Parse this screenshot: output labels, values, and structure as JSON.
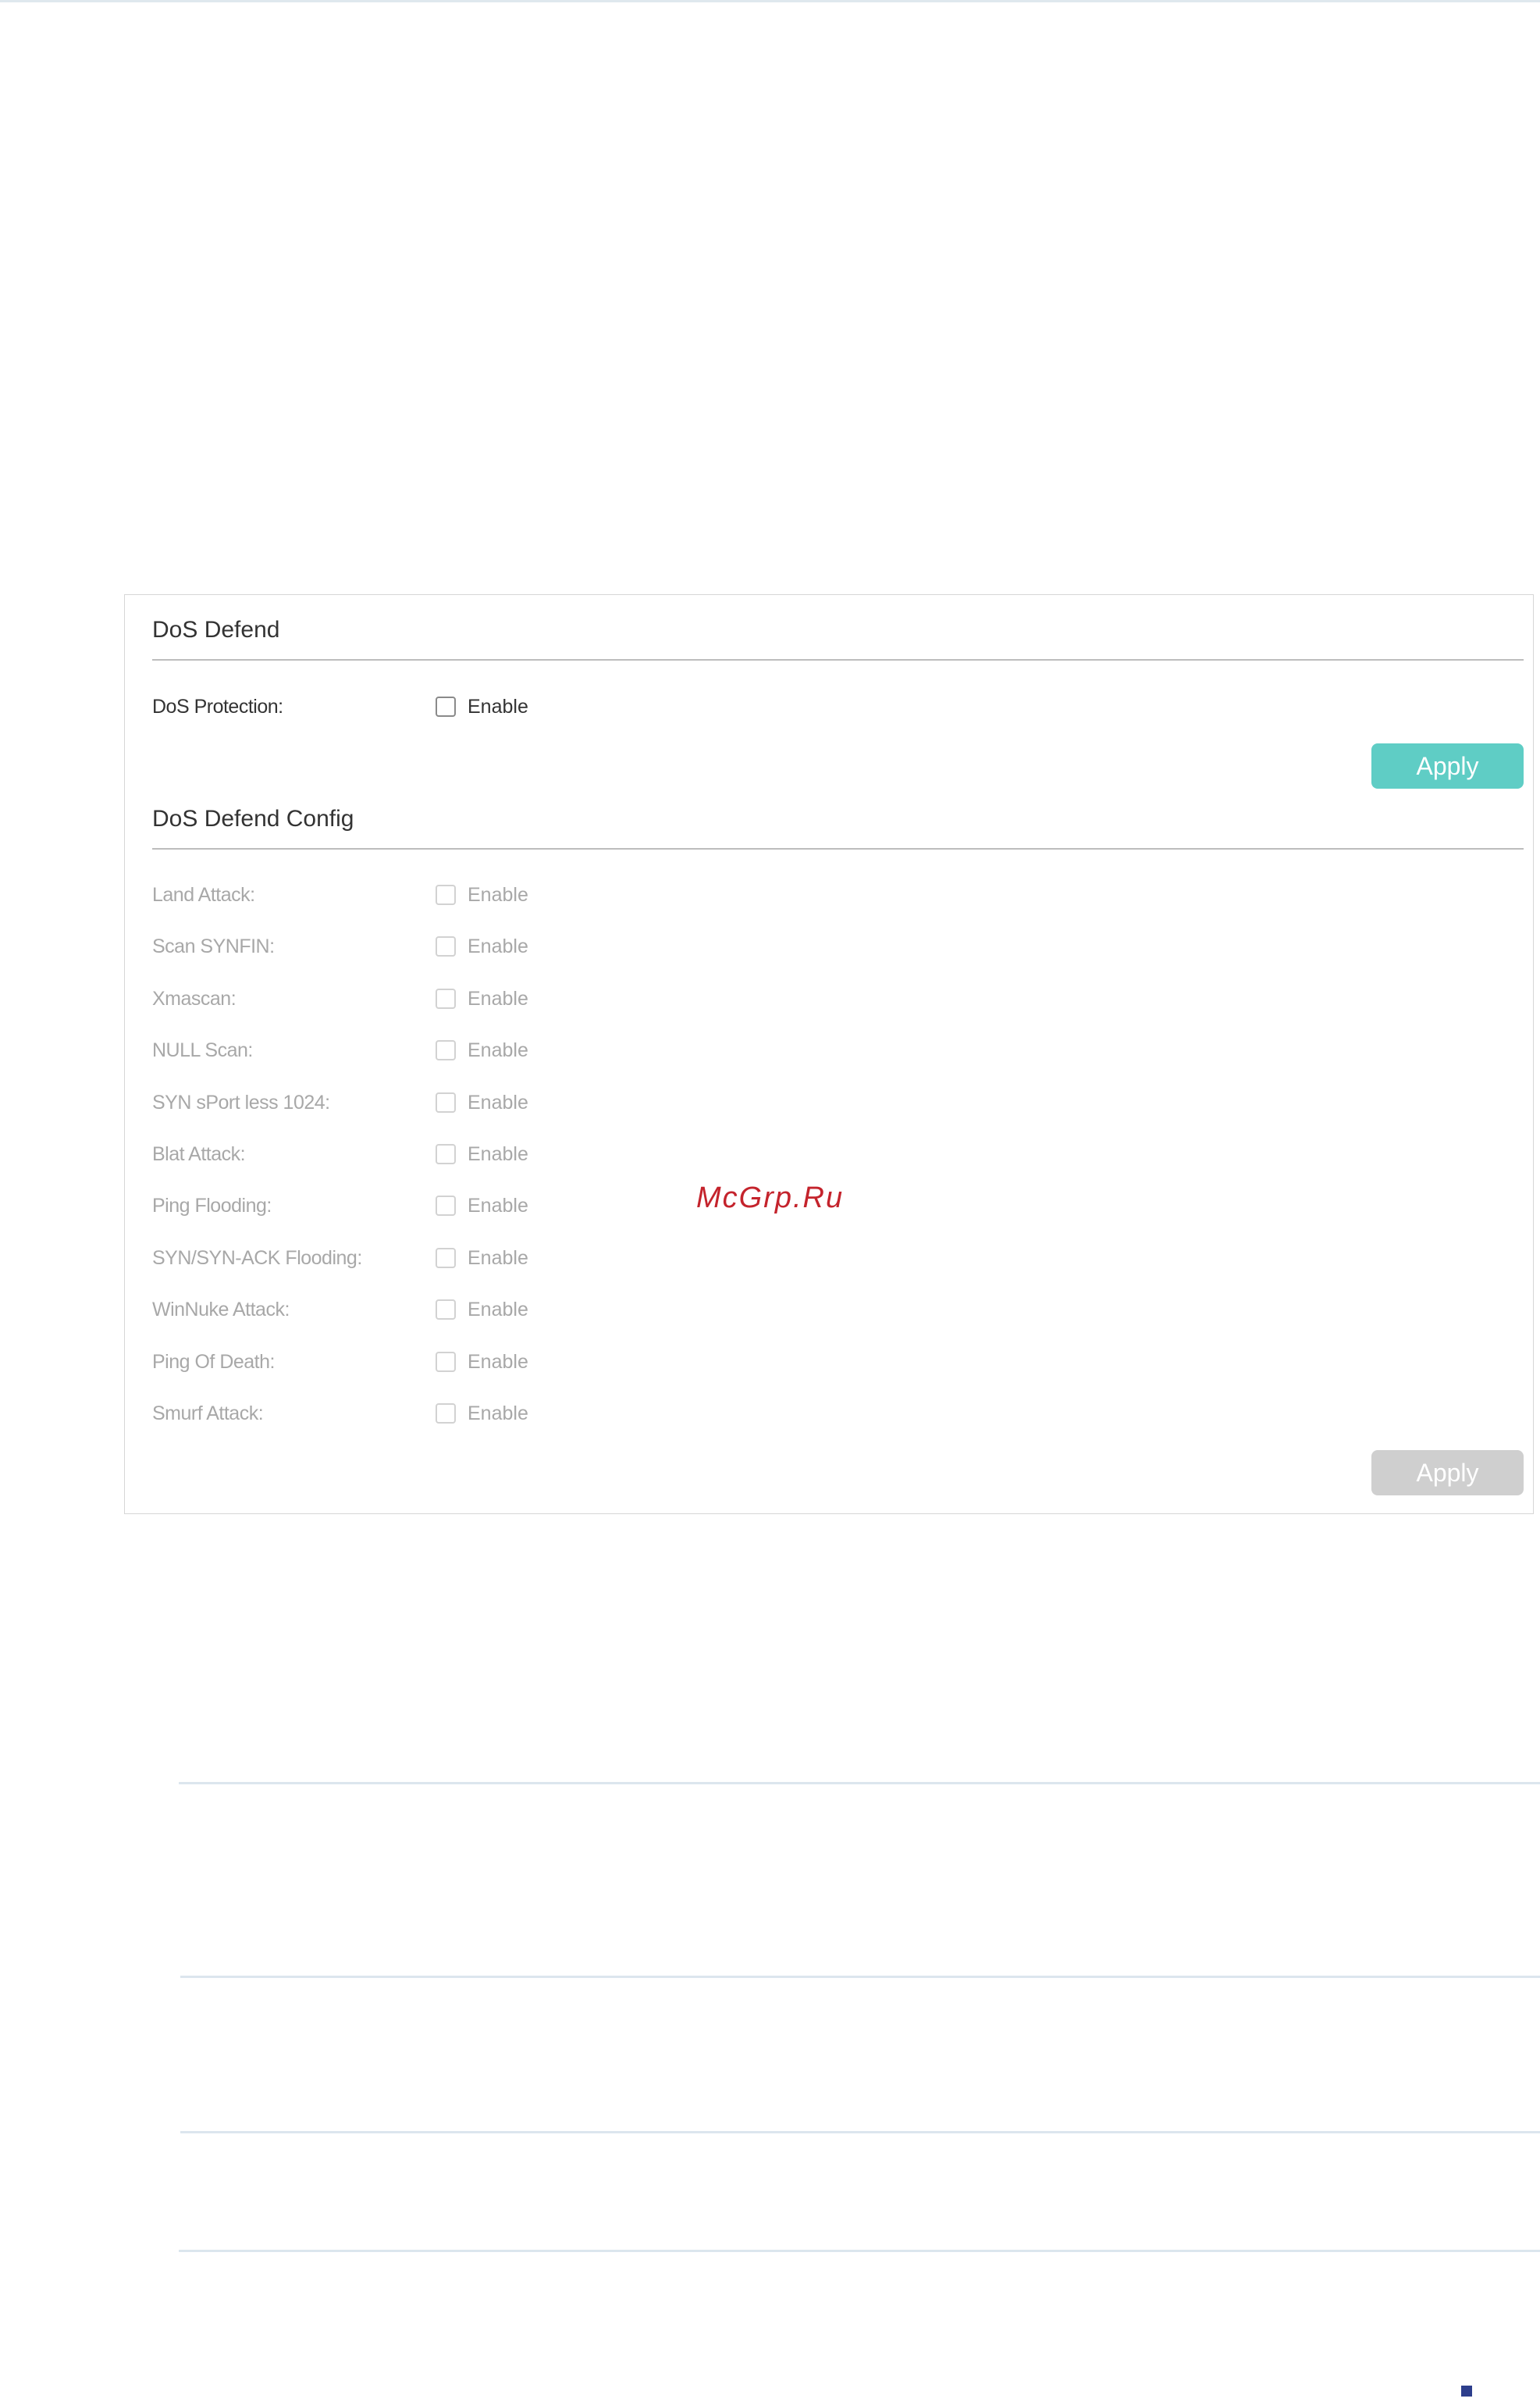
{
  "dos_defend": {
    "title": "DoS Defend",
    "protection_label": "DoS Protection:",
    "enable_label": "Enable",
    "protection_checked": false,
    "apply_label": "Apply"
  },
  "dos_defend_config": {
    "title": "DoS Defend Config",
    "enable_label": "Enable",
    "items": [
      {
        "label": "Land Attack:",
        "checked": false
      },
      {
        "label": "Scan SYNFIN:",
        "checked": false
      },
      {
        "label": "Xmascan:",
        "checked": false
      },
      {
        "label": "NULL Scan:",
        "checked": false
      },
      {
        "label": "SYN sPort less 1024:",
        "checked": false
      },
      {
        "label": "Blat Attack:",
        "checked": false
      },
      {
        "label": "Ping Flooding:",
        "checked": false
      },
      {
        "label": "SYN/SYN-ACK Flooding:",
        "checked": false
      },
      {
        "label": "WinNuke Attack:",
        "checked": false
      },
      {
        "label": "Ping Of Death:",
        "checked": false
      },
      {
        "label": "Smurf Attack:",
        "checked": false
      }
    ],
    "apply_label": "Apply"
  },
  "watermark": "McGrp.Ru",
  "colors": {
    "apply_active": "#5fcdc5",
    "apply_disabled": "#cfcfcf",
    "watermark": "#c4232c"
  }
}
